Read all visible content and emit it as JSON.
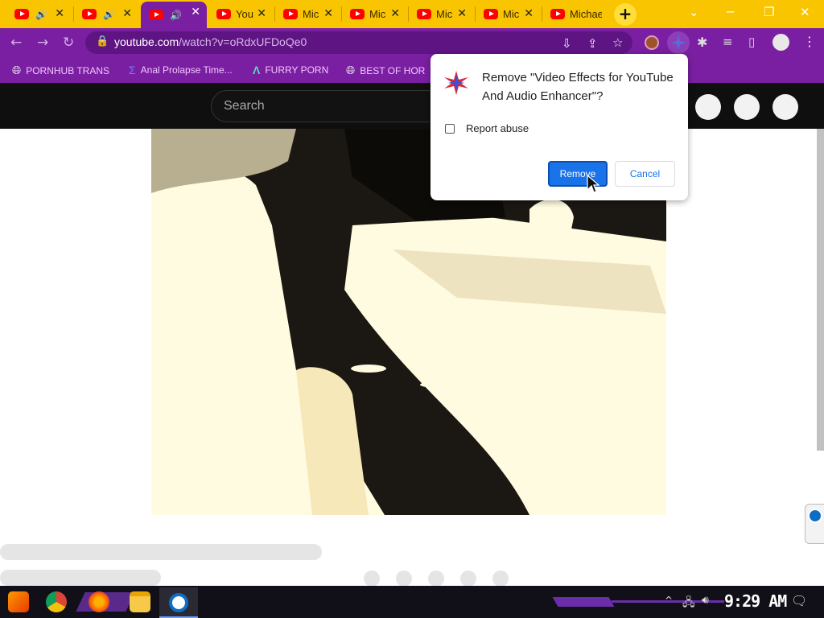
{
  "tabs": [
    {
      "title": "",
      "audio": "🔊",
      "active": false
    },
    {
      "title": "",
      "audio": "🔊",
      "active": false
    },
    {
      "title": "",
      "audio": "🔊",
      "active": true
    },
    {
      "title": "You",
      "audio": "",
      "active": false
    },
    {
      "title": "Mic",
      "audio": "",
      "active": false
    },
    {
      "title": "Mic",
      "audio": "",
      "active": false
    },
    {
      "title": "Mic",
      "audio": "",
      "active": false
    },
    {
      "title": "Mic",
      "audio": "",
      "active": false
    },
    {
      "title": "Michae",
      "audio": "",
      "active": false
    }
  ],
  "toolbar": {
    "url_host": "youtube.com",
    "url_path": "/watch?v=oRdxUFDoQe0"
  },
  "bookmarks": [
    {
      "label": "PORNHUB TRANS",
      "icon": "globe-icon"
    },
    {
      "label": "Anal Prolapse Time...",
      "icon": "sigma-icon"
    },
    {
      "label": "FURRY PORN",
      "icon": "lambda-icon"
    },
    {
      "label": "BEST OF HOR",
      "icon": "globe-icon"
    }
  ],
  "youtube": {
    "search_placeholder": "Search"
  },
  "dialog": {
    "title": "Remove \"Video Effects for YouTube And Audio Enhancer\"?",
    "checkbox_label": "Report abuse",
    "remove_label": "Remove",
    "cancel_label": "Cancel"
  },
  "taskbar": {
    "clock": "9:29 AM"
  },
  "colors": {
    "tab_strip": "#f9c400",
    "toolbar": "#7a1fa2",
    "primary_button": "#1a73e8"
  }
}
